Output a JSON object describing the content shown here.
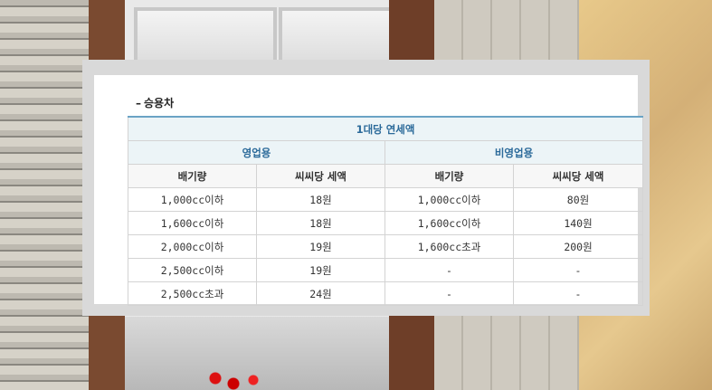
{
  "section": {
    "dash": "–",
    "title": "승용차"
  },
  "table": {
    "header_top": "1대당 연세액",
    "group_business": "영업용",
    "group_nonbusiness": "비영업용",
    "col_displacement_a": "배기량",
    "col_tax_a": "씨씨당 세액",
    "col_displacement_b": "배기량",
    "col_tax_b": "씨씨당 세액",
    "rows": [
      {
        "disp_a": "1,000cc이하",
        "tax_a": "18원",
        "disp_b": "1,000cc이하",
        "tax_b": "80원"
      },
      {
        "disp_a": "1,600cc이하",
        "tax_a": "18원",
        "disp_b": "1,600cc이하",
        "tax_b": "140원"
      },
      {
        "disp_a": "2,000cc이하",
        "tax_a": "19원",
        "disp_b": "1,600cc초과",
        "tax_b": "200원"
      },
      {
        "disp_a": "2,500cc이하",
        "tax_a": "19원",
        "disp_b": "-",
        "tax_b": "-"
      },
      {
        "disp_a": "2,500cc초과",
        "tax_a": "24원",
        "disp_b": "-",
        "tax_b": "-"
      }
    ]
  }
}
